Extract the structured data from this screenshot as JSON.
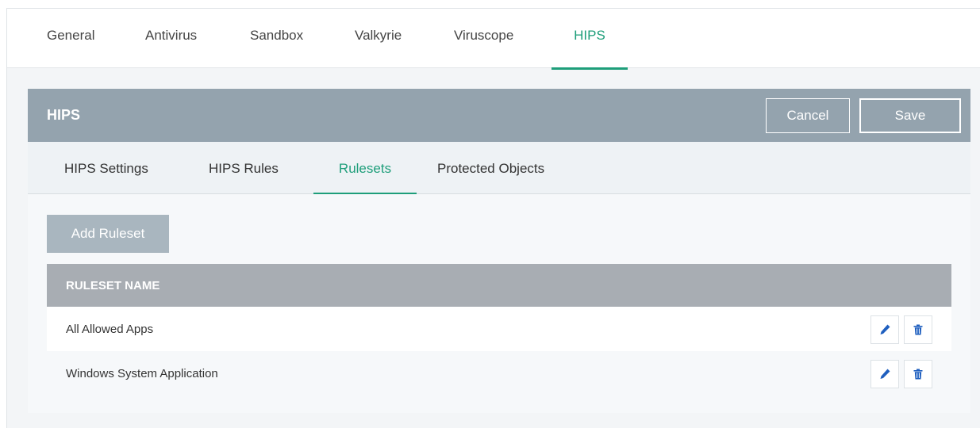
{
  "top_tabs": [
    {
      "label": "General",
      "active": false
    },
    {
      "label": "Antivirus",
      "active": false
    },
    {
      "label": "Sandbox",
      "active": false
    },
    {
      "label": "Valkyrie",
      "active": false
    },
    {
      "label": "Viruscope",
      "active": false
    },
    {
      "label": "HIPS",
      "active": true
    }
  ],
  "panel": {
    "title": "HIPS",
    "cancel_label": "Cancel",
    "save_label": "Save"
  },
  "sub_tabs": [
    {
      "label": "HIPS Settings",
      "active": false
    },
    {
      "label": "HIPS Rules",
      "active": false
    },
    {
      "label": "Rulesets",
      "active": true
    },
    {
      "label": "Protected Objects",
      "active": false
    }
  ],
  "add_button_label": "Add Ruleset",
  "table": {
    "header": "RULESET NAME",
    "rows": [
      {
        "name": "All Allowed Apps",
        "actions": [
          "edit-icon",
          "trash-icon"
        ]
      },
      {
        "name": "Windows System Application",
        "actions": [
          "edit-icon",
          "trash-icon"
        ]
      }
    ]
  },
  "colors": {
    "accent": "#1e9e7a",
    "header_bg": "#94a3ae",
    "table_header_bg": "#a8adb3",
    "icon_blue": "#1f5fbf"
  }
}
